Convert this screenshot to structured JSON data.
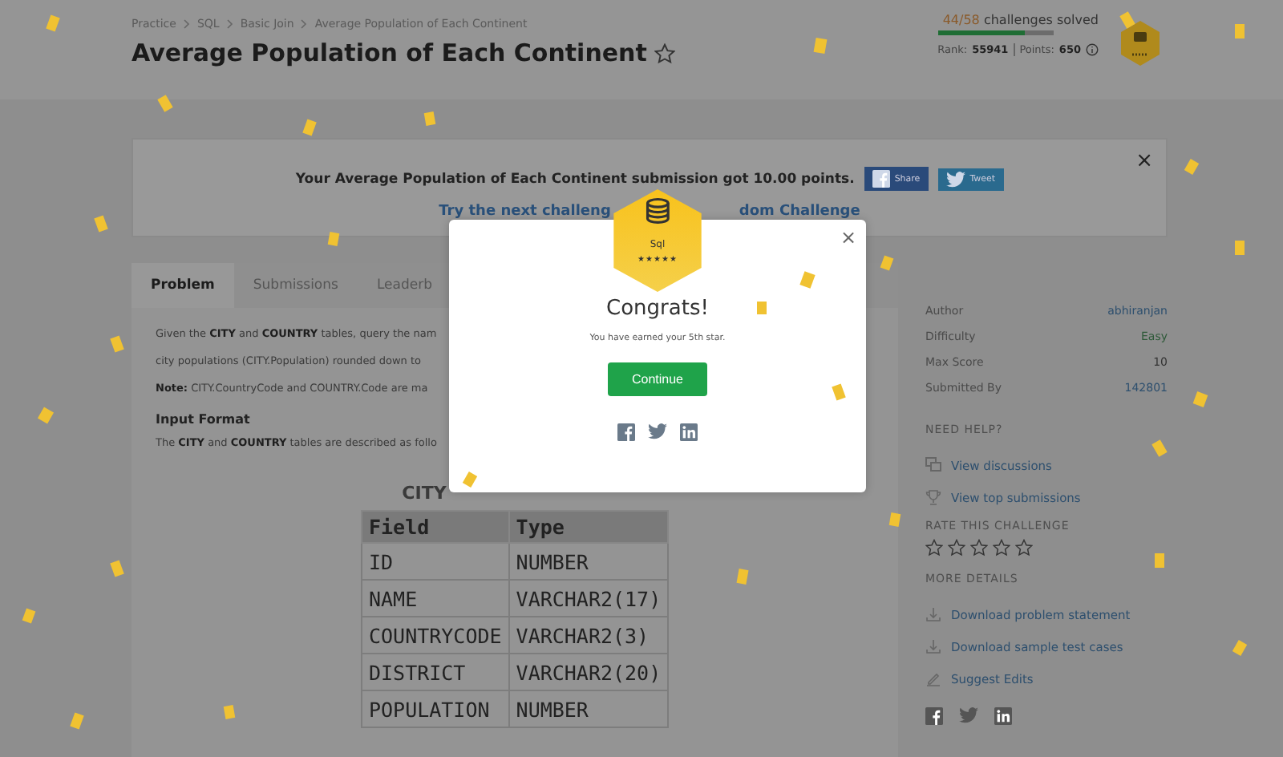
{
  "breadcrumb": [
    "Practice",
    "SQL",
    "Basic Join",
    "Average Population of Each Continent"
  ],
  "title": "Average Population of Each Continent",
  "progress": {
    "solved": "44/58",
    "label": "challenges solved",
    "level": 0.76,
    "rank_label": "Rank:",
    "rank": "55941",
    "points_label": "Points:",
    "points": "650"
  },
  "banner": {
    "message": "Your Average Population of Each Continent submission got 10.00 points.",
    "share": "Share",
    "tweet": "Tweet",
    "close": "×",
    "next_left": "Try the next challeng",
    "next_right": "dom Challenge"
  },
  "tabs": [
    {
      "label": "Problem",
      "selected": true
    },
    {
      "label": "Submissions",
      "selected": false
    },
    {
      "label": "Leaderb",
      "selected": false
    }
  ],
  "problem": {
    "lines": [
      "Given the **CITY** and **COUNTRY** tables, query the nam",
      "city populations (CITY.Population) rounded down to",
      "**Note:** CITY.CountryCode and COUNTRY.Code are ma"
    ],
    "input_heading": "Input Format",
    "input_line": "The **CITY** and **COUNTRY** tables are described as follo",
    "table_title": "CITY",
    "columns": [
      "Field",
      "Type"
    ],
    "rows": [
      [
        "ID",
        "NUMBER"
      ],
      [
        "NAME",
        "VARCHAR2(17)"
      ],
      [
        "COUNTRYCODE",
        "VARCHAR2(3)"
      ],
      [
        "DISTRICT",
        "VARCHAR2(20)"
      ],
      [
        "POPULATION",
        "NUMBER"
      ]
    ]
  },
  "sidebar": {
    "details": [
      {
        "label": "Author",
        "value": "abhiranjan",
        "kind": "link"
      },
      {
        "label": "Difficulty",
        "value": "Easy",
        "kind": "easy"
      },
      {
        "label": "Max Score",
        "value": "10",
        "kind": "plain"
      },
      {
        "label": "Submitted By",
        "value": "142801",
        "kind": "link"
      }
    ],
    "help_heading": "NEED HELP?",
    "help_links": [
      {
        "label": "View discussions",
        "kind": "discussion"
      },
      {
        "label": "View top submissions",
        "kind": "trophy"
      }
    ],
    "rating_heading": "RATE THIS CHALLENGE",
    "stars": 0,
    "more_heading": "MORE DETAILS",
    "more_links": [
      {
        "label": "Download problem statement",
        "kind": "download"
      },
      {
        "label": "Download sample test cases",
        "kind": "download"
      },
      {
        "label": "Suggest Edits",
        "kind": "edit"
      }
    ]
  },
  "modal": {
    "badge_name": "Sql",
    "badge_stars": "★★★★★",
    "title": "Congrats!",
    "message": "You have earned your 5th star.",
    "button": "Continue",
    "close": "×"
  }
}
